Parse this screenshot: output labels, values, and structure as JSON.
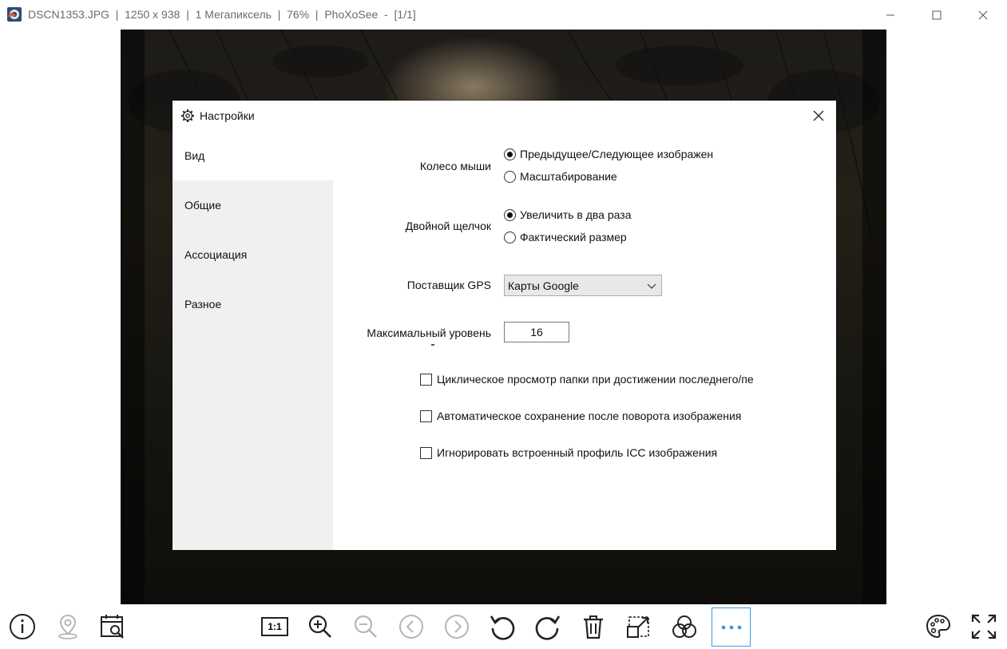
{
  "window": {
    "title": "DSCN1353.JPG  |  1250 x 938  |  1 Мегапиксель  |  76%  |  PhoXoSee  -  [1/1]",
    "minimize_icon": "minimize-icon",
    "maximize_icon": "maximize-icon",
    "close_icon": "close-icon"
  },
  "dialog": {
    "title": "Настройки",
    "nav": [
      {
        "label": "Вид",
        "active": true
      },
      {
        "label": "Общие",
        "active": false
      },
      {
        "label": "Ассоциация",
        "active": false
      },
      {
        "label": "Разное",
        "active": false
      }
    ],
    "mouse_wheel": {
      "label": "Колесо мыши",
      "options": [
        {
          "label": "Предыдущее/Следующее изображен",
          "checked": true
        },
        {
          "label": "Масштабирование",
          "checked": false
        }
      ]
    },
    "double_click": {
      "label": "Двойной щелчок",
      "options": [
        {
          "label": "Увеличить в два раза",
          "checked": true
        },
        {
          "label": "Фактический размер",
          "checked": false
        }
      ]
    },
    "gps_provider": {
      "label": "Поставщик GPS",
      "value": "Карты Google"
    },
    "max_level": {
      "label": "Максимальный уровень",
      "value": "16"
    },
    "checkboxes": [
      {
        "label": "Циклическое просмотр папки при достижении последнего/пе",
        "checked": false
      },
      {
        "label": "Автоматическое сохранение после поворота изображения",
        "checked": false
      },
      {
        "label": "Игнорировать встроенный профиль ICC изображения",
        "checked": false
      }
    ]
  },
  "toolbar": {
    "actual_size_label": "1:1",
    "buttons": [
      "info-icon",
      "map-pin-icon",
      "calendar-search-icon",
      "actual-size-icon",
      "zoom-in-icon",
      "zoom-out-icon",
      "previous-icon",
      "next-icon",
      "rotate-left-icon",
      "rotate-right-icon",
      "trash-icon",
      "crop-resize-icon",
      "color-circles-icon",
      "more-icon",
      "palette-icon",
      "fullscreen-icon"
    ]
  },
  "colors": {
    "accent": "#3a9be3",
    "nav_bg": "#f0f0f0",
    "disabled_icon": "#b5b5b5"
  }
}
